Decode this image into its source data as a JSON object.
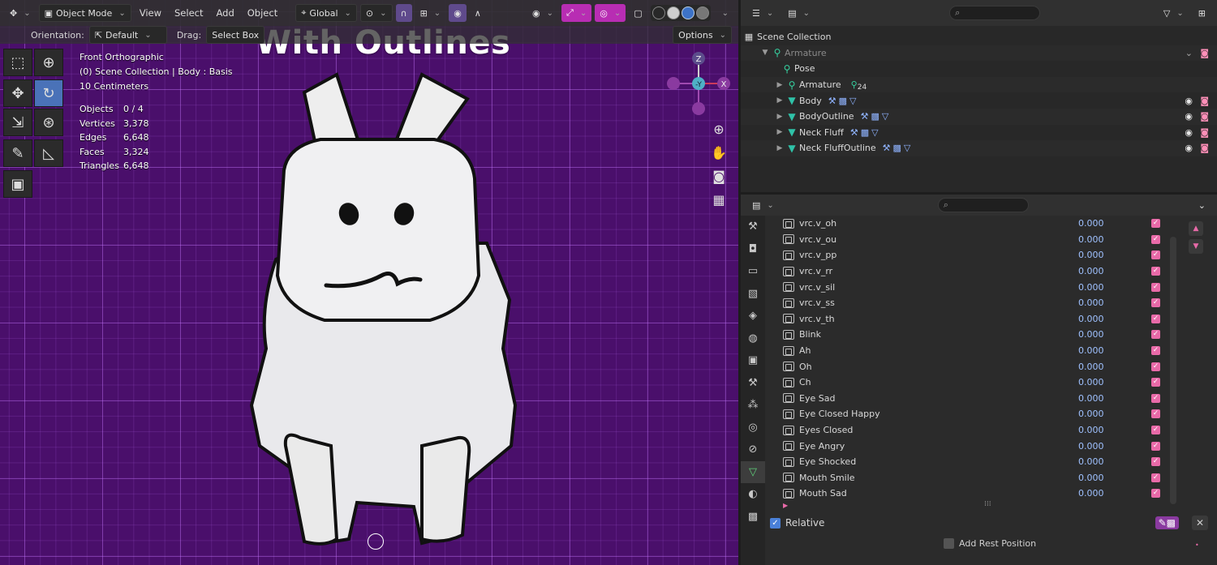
{
  "overlay_title": "With Outlines",
  "viewport_header": {
    "mode": "Object Mode",
    "menus": [
      "View",
      "Select",
      "Add",
      "Object"
    ],
    "transform_orientation": "Global"
  },
  "viewport_subheader": {
    "orientation_label": "Orientation:",
    "orientation_value": "Default",
    "drag_label": "Drag:",
    "drag_value": "Select Box",
    "options_label": "Options"
  },
  "viewport_info": {
    "view_name": "Front Orthographic",
    "context": "(0) Scene Collection | Body : Basis",
    "scale": "10 Centimeters"
  },
  "stats": [
    {
      "label": "Objects",
      "value": "0 / 4"
    },
    {
      "label": "Vertices",
      "value": "3,378"
    },
    {
      "label": "Edges",
      "value": "6,648"
    },
    {
      "label": "Faces",
      "value": "3,324"
    },
    {
      "label": "Triangles",
      "value": "6,648"
    }
  ],
  "gizmo": {
    "z": "Z",
    "y": "-Y",
    "x": "X"
  },
  "outliner": {
    "root": "Scene Collection",
    "items": [
      {
        "label": "Armature",
        "icon": "armature-icon",
        "dim": true
      },
      {
        "label": "Pose",
        "icon": "pose-icon"
      },
      {
        "label": "Armature",
        "icon": "armature-data-icon",
        "badge": "24"
      },
      {
        "label": "Body",
        "icon": "mesh-icon"
      },
      {
        "label": "BodyOutline",
        "icon": "mesh-icon"
      },
      {
        "label": "Neck Fluff",
        "icon": "mesh-icon"
      },
      {
        "label": "Neck FluffOutline",
        "icon": "mesh-icon"
      }
    ]
  },
  "shape_keys": [
    {
      "name": "vrc.v_oh",
      "value": "0.000"
    },
    {
      "name": "vrc.v_ou",
      "value": "0.000"
    },
    {
      "name": "vrc.v_pp",
      "value": "0.000"
    },
    {
      "name": "vrc.v_rr",
      "value": "0.000"
    },
    {
      "name": "vrc.v_sil",
      "value": "0.000"
    },
    {
      "name": "vrc.v_ss",
      "value": "0.000"
    },
    {
      "name": "vrc.v_th",
      "value": "0.000"
    },
    {
      "name": "Blink",
      "value": "0.000"
    },
    {
      "name": "Ah",
      "value": "0.000"
    },
    {
      "name": "Oh",
      "value": "0.000"
    },
    {
      "name": "Ch",
      "value": "0.000"
    },
    {
      "name": "Eye Sad",
      "value": "0.000"
    },
    {
      "name": "Eye Closed Happy",
      "value": "0.000"
    },
    {
      "name": "Eyes Closed",
      "value": "0.000"
    },
    {
      "name": "Eye Angry",
      "value": "0.000"
    },
    {
      "name": "Eye Shocked",
      "value": "0.000"
    },
    {
      "name": "Mouth Smile",
      "value": "0.000"
    },
    {
      "name": "Mouth Sad",
      "value": "0.000"
    }
  ],
  "relative_label": "Relative",
  "rest_label": "Add Rest Position",
  "colors": {
    "viewport_bg": "#4a0f6b",
    "accent_pink": "#e86aa8",
    "active_blue": "#4a72b8"
  }
}
